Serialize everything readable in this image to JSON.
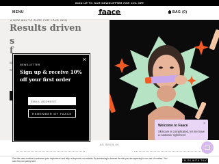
{
  "announcement": {
    "text": "SIGN UP TO OUR NEWSLETTER FOR 10% OFF"
  },
  "header": {
    "menu_label": "MENU",
    "logo": "faace",
    "bag_label": "BAG (0)"
  },
  "hero": {
    "tagline": "A NEW WAY TO SHOP FOR YOUR SKIN",
    "heading": "Results driven",
    "heading_frag_2": "s",
    "heading_frag_3": "f",
    "body_frag_1": "M",
    "body_frag_2": "w"
  },
  "popup": {
    "kicker": "NEWSLETTER",
    "title_line1": "Sign up & receive 10%",
    "title_line2": "off your first order",
    "email_placeholder": "EMAIL ADDRESS",
    "submit_label": "REMEMBER MY FAACE",
    "close_symbol": "×"
  },
  "chat": {
    "title": "Welcome to Faace",
    "message": "Skincare is complicated, let me have a customer right here!",
    "close_symbol": "×"
  },
  "section": {
    "as_seen_in": "AS SEEN IN"
  },
  "cookie": {
    "text": "Our site uses cookies to enhance your experience and help us improve our website. By continuing to browse the site you are agreeing to our use of cookies. You can view our policy here.",
    "button_label": "I'M OK WITH THAT"
  },
  "colors": {
    "accent_orange": "#f15a24",
    "accent_green": "#b6e3c4",
    "chat_purple": "#e9d6f6",
    "tube_lilac": "#c9a7ec"
  }
}
